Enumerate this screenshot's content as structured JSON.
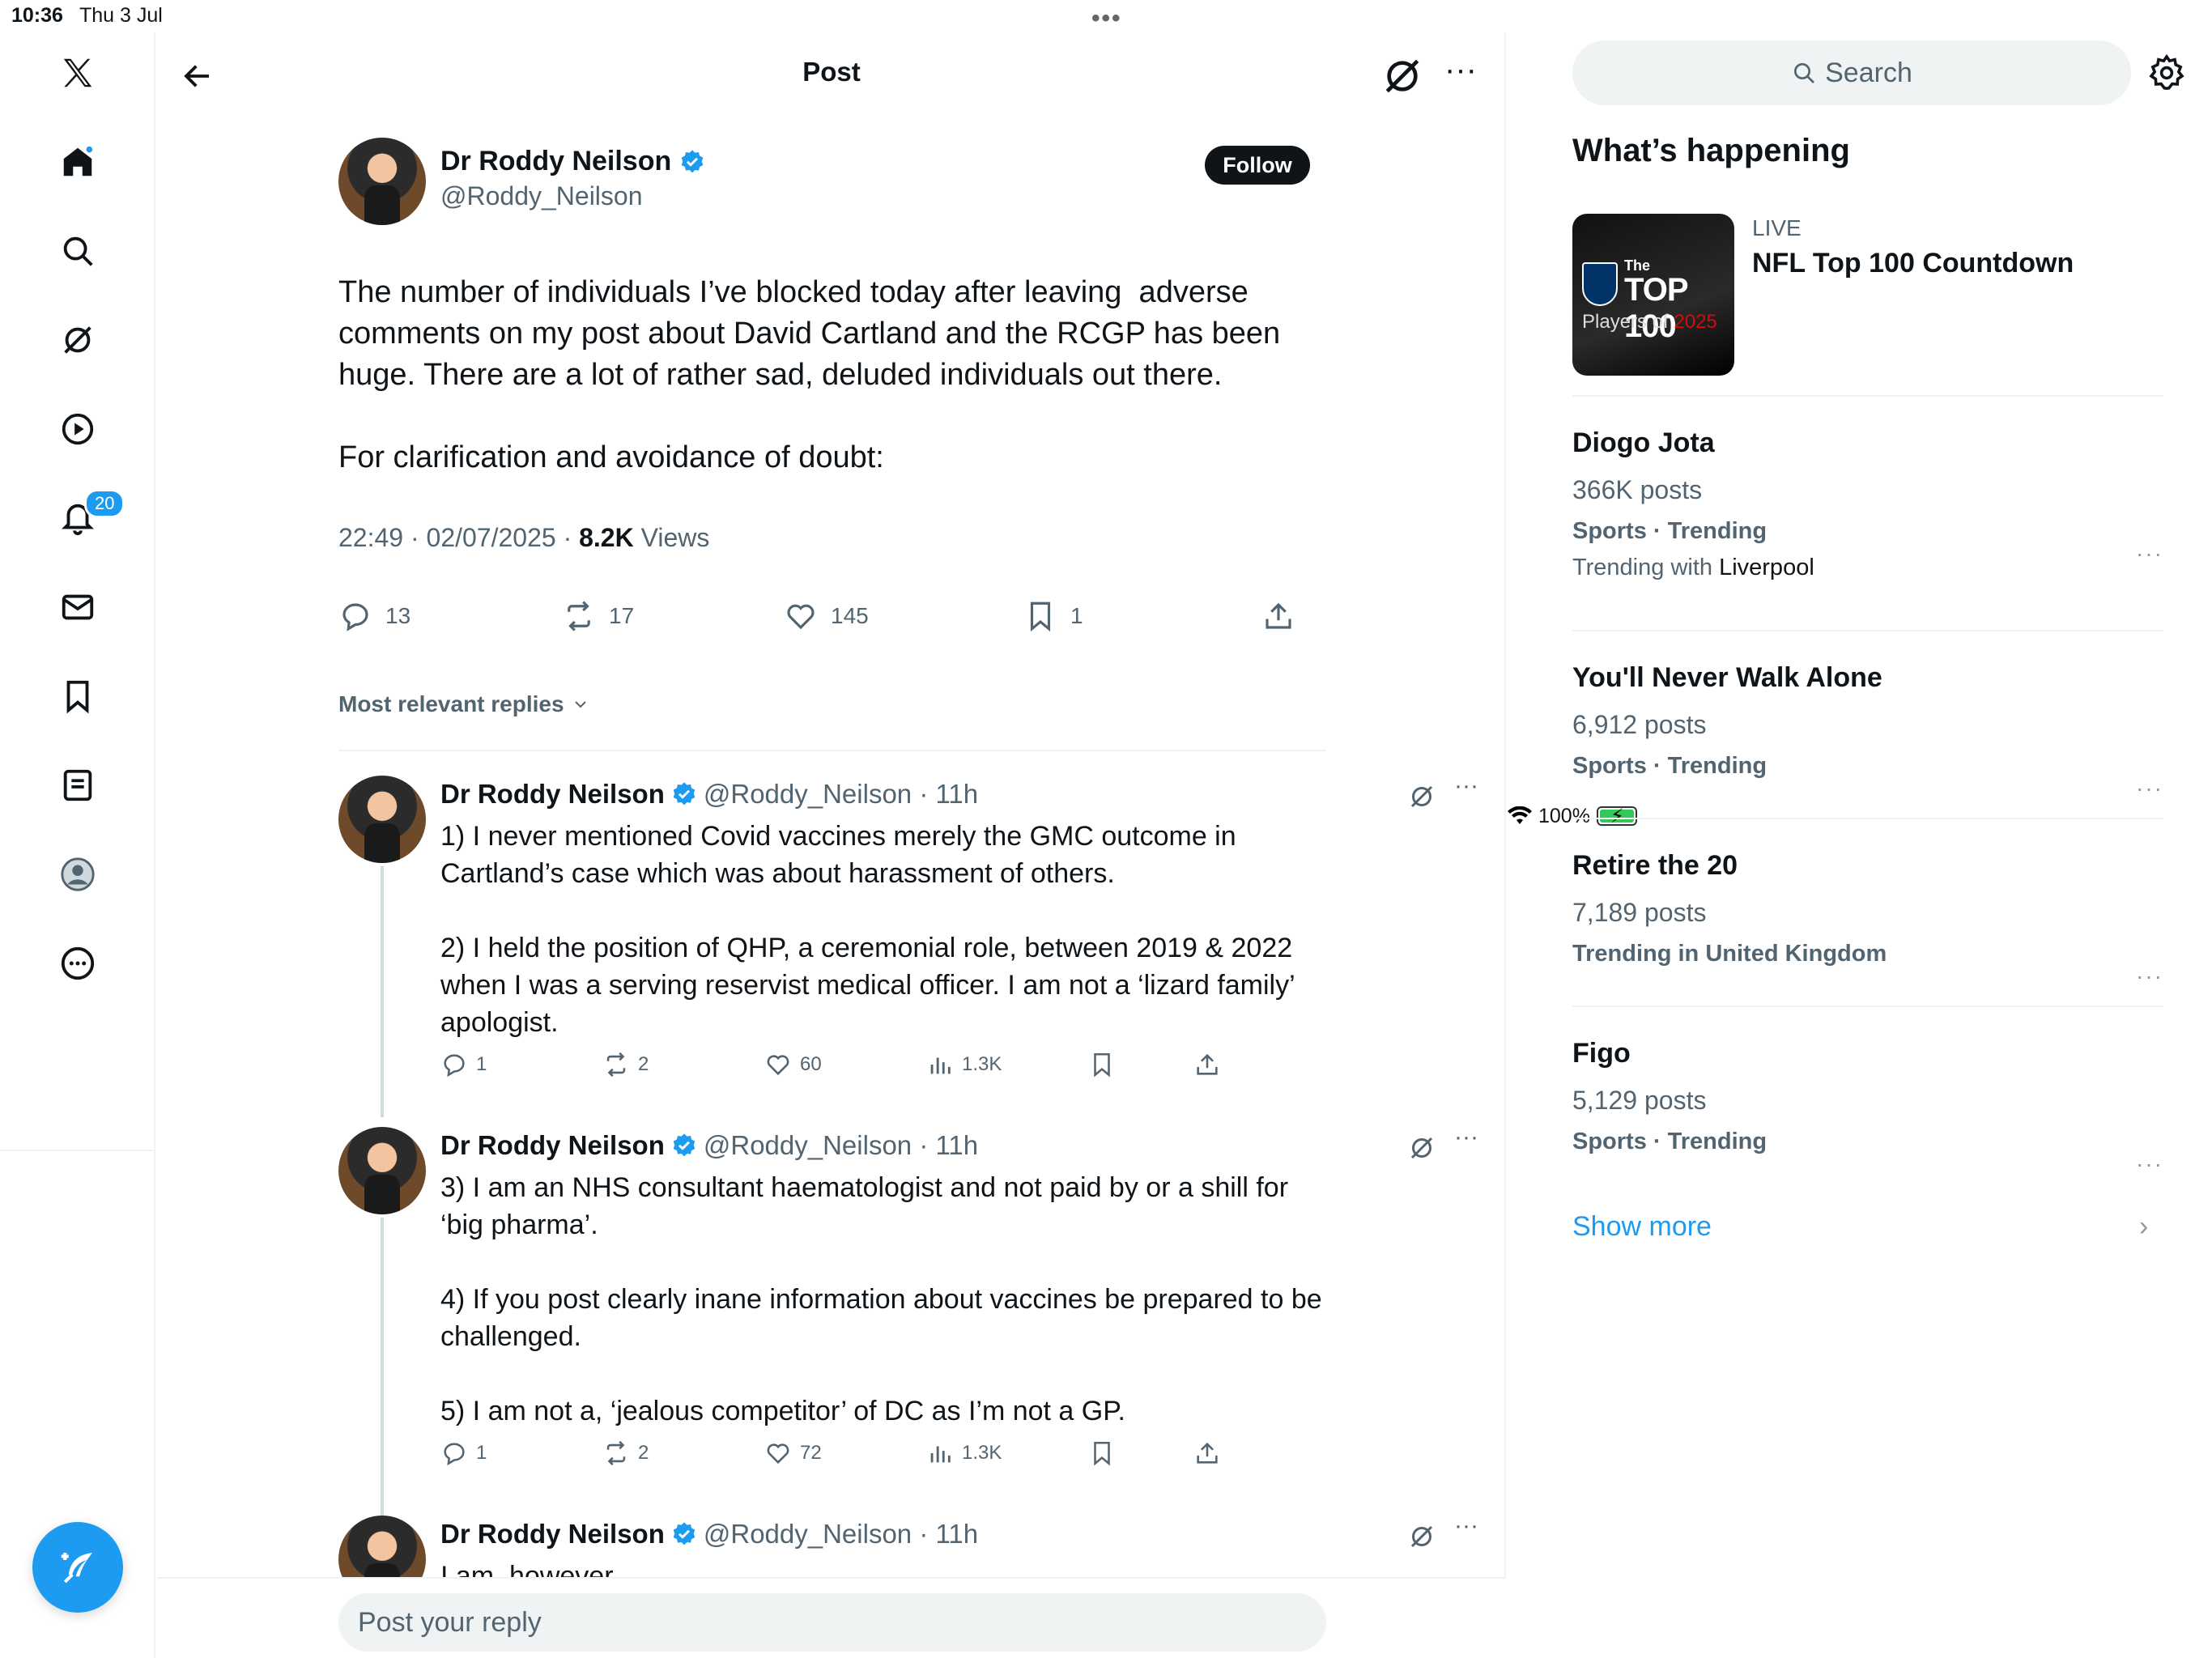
{
  "status_bar": {
    "time": "10:36",
    "date": "Thu 3 Jul",
    "battery": "100%"
  },
  "nav": {
    "items": [
      "x-logo",
      "home",
      "search",
      "grok",
      "video",
      "notifications",
      "messages",
      "bookmarks",
      "lists",
      "profile",
      "more"
    ],
    "notifications_badge": "20"
  },
  "header": {
    "title": "Post"
  },
  "post": {
    "author_name": "Dr Roddy Neilson",
    "author_handle": "@Roddy_Neilson",
    "follow_label": "Follow",
    "text": "The number of individuals I’ve blocked today after leaving  adverse comments on my post about David Cartland and the RCGP has been huge. There are a lot of rather sad, deluded individuals out there.\n\nFor clarification and avoidance of doubt:",
    "timestamp": "22:49 · 02/07/2025 · ",
    "views_count": "8.2K",
    "views_label": " Views",
    "replies": "13",
    "reposts": "17",
    "likes": "145",
    "bookmarks": "1"
  },
  "sort_label": "Most relevant replies",
  "replies": [
    {
      "name": "Dr Roddy Neilson",
      "handle_time": "@Roddy_Neilson · 11h",
      "text": "1) I never mentioned Covid vaccines merely the GMC outcome in Cartland’s case which was about harassment of others.\n\n2) I held the position of QHP, a ceremonial role, between 2019 & 2022 when I was a serving reservist medical officer. I am not a ‘lizard family’ apologist.",
      "replies": "1",
      "reposts": "2",
      "likes": "60",
      "views": "1.3K"
    },
    {
      "name": "Dr Roddy Neilson",
      "handle_time": "@Roddy_Neilson · 11h",
      "text": "3) I am an NHS consultant haematologist and not paid by or a shill for ‘big pharma’.\n\n4) If you post clearly inane information about vaccines be prepared to be challenged.\n\n5) I am not a, ‘jealous competitor’ of DC as I’m not a GP.",
      "replies": "1",
      "reposts": "2",
      "likes": "72",
      "views": "1.3K"
    },
    {
      "name": "Dr Roddy Neilson",
      "handle_time": "@Roddy_Neilson · 11h",
      "text": "I am, however,"
    }
  ],
  "reply_input": {
    "placeholder": "Post your reply"
  },
  "sidebar": {
    "search_placeholder": "Search",
    "whats_happening": "What’s happening",
    "live": {
      "label": "LIVE",
      "title": "NFL Top 100 Countdown",
      "thumb_line1": "The",
      "thumb_line2": "TOP 100",
      "thumb_line3a": "Players of ",
      "thumb_line3b": "2025"
    },
    "trends": [
      {
        "name": "Diogo Jota",
        "posts": "366K posts",
        "category": "Sports · Trending",
        "with_prefix": "Trending with ",
        "with_name": "Liverpool"
      },
      {
        "name": "You'll Never Walk Alone",
        "posts": "6,912 posts",
        "category": "Sports · Trending"
      },
      {
        "name": "Retire the 20",
        "posts": "7,189 posts",
        "category": "Trending in United Kingdom"
      },
      {
        "name": "Figo",
        "posts": "5,129 posts",
        "category": "Sports · Trending"
      }
    ],
    "show_more": "Show more"
  },
  "colors": {
    "accent": "#1d9bf0",
    "text": "#0f1419",
    "secondary": "#536471",
    "divider": "#eff3f4"
  }
}
